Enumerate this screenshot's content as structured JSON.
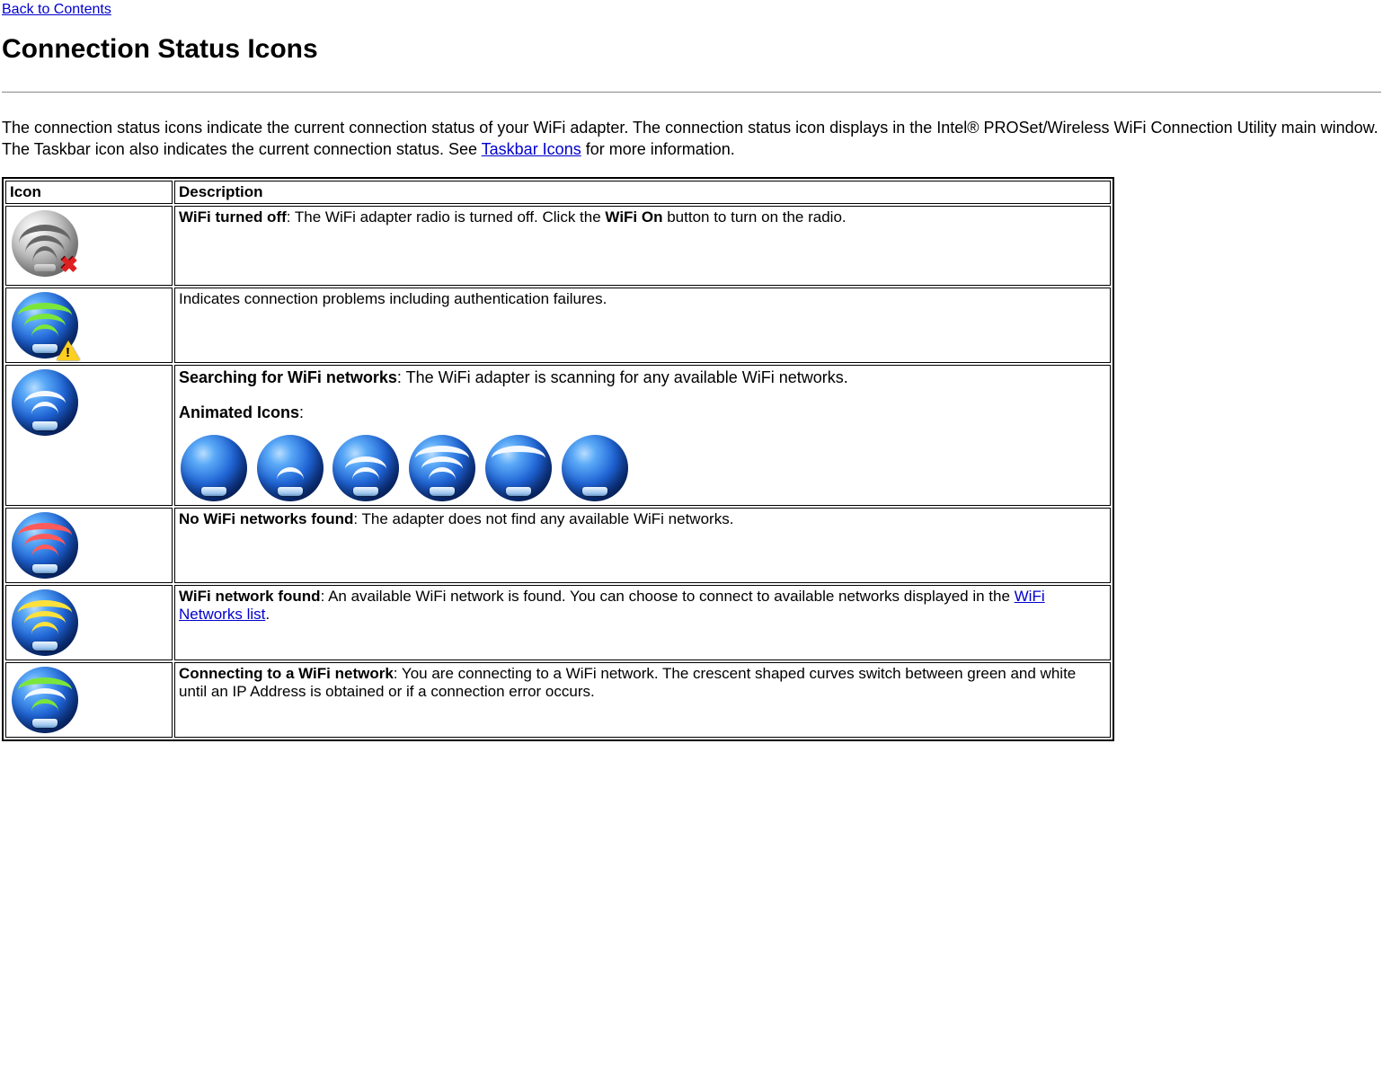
{
  "nav": {
    "back_link": "Back to Contents"
  },
  "heading": "Connection Status Icons",
  "intro": {
    "before_link": "The connection status icons indicate the current connection status of your WiFi adapter. The connection status icon displays in the Intel® PROSet/Wireless WiFi Connection Utility main window. The Taskbar icon also indicates the current connection status. See ",
    "link": "Taskbar Icons",
    "after_link": " for more information."
  },
  "table": {
    "headers": {
      "icon": "Icon",
      "description": "Description"
    },
    "rows": [
      {
        "icon": "wifi-off",
        "desc": {
          "bold1": "WiFi turned off",
          "text1": ": The WiFi adapter radio is turned off. Click the ",
          "bold2": "WiFi On",
          "text2": " button to turn on the radio."
        }
      },
      {
        "icon": "wifi-trouble",
        "desc": {
          "text1": "Indicates connection problems including authentication failures."
        }
      },
      {
        "icon": "wifi-searching",
        "desc": {
          "bold1": "Searching for WiFi networks",
          "text1": ": The WiFi adapter is scanning for any available WiFi networks.",
          "bold2": "Animated Icons",
          "text2": ":"
        },
        "animated": true
      },
      {
        "icon": "wifi-none-found",
        "desc": {
          "bold1": "No WiFi networks found",
          "text1": ": The adapter does not find any available WiFi networks."
        }
      },
      {
        "icon": "wifi-found",
        "desc": {
          "bold1": "WiFi network found",
          "text1": ": An available WiFi network is found. You can choose to connect to available networks displayed in the ",
          "link": "WiFi Networks list",
          "text2": "."
        }
      },
      {
        "icon": "wifi-connecting",
        "desc": {
          "bold1": "Connecting to a WiFi network",
          "text1": ": You are connecting to a WiFi network. The crescent shaped curves switch between green and white until an IP Address is obtained or if a connection error occurs."
        }
      }
    ]
  }
}
